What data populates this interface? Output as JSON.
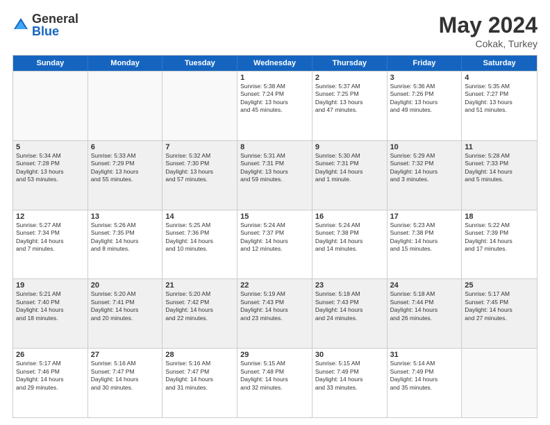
{
  "logo": {
    "general": "General",
    "blue": "Blue"
  },
  "title": {
    "month_year": "May 2024",
    "location": "Cokak, Turkey"
  },
  "weekdays": [
    "Sunday",
    "Monday",
    "Tuesday",
    "Wednesday",
    "Thursday",
    "Friday",
    "Saturday"
  ],
  "rows": [
    [
      {
        "day": "",
        "info": ""
      },
      {
        "day": "",
        "info": ""
      },
      {
        "day": "",
        "info": ""
      },
      {
        "day": "1",
        "info": "Sunrise: 5:38 AM\nSunset: 7:24 PM\nDaylight: 13 hours\nand 45 minutes."
      },
      {
        "day": "2",
        "info": "Sunrise: 5:37 AM\nSunset: 7:25 PM\nDaylight: 13 hours\nand 47 minutes."
      },
      {
        "day": "3",
        "info": "Sunrise: 5:36 AM\nSunset: 7:26 PM\nDaylight: 13 hours\nand 49 minutes."
      },
      {
        "day": "4",
        "info": "Sunrise: 5:35 AM\nSunset: 7:27 PM\nDaylight: 13 hours\nand 51 minutes."
      }
    ],
    [
      {
        "day": "5",
        "info": "Sunrise: 5:34 AM\nSunset: 7:28 PM\nDaylight: 13 hours\nand 53 minutes."
      },
      {
        "day": "6",
        "info": "Sunrise: 5:33 AM\nSunset: 7:29 PM\nDaylight: 13 hours\nand 55 minutes."
      },
      {
        "day": "7",
        "info": "Sunrise: 5:32 AM\nSunset: 7:30 PM\nDaylight: 13 hours\nand 57 minutes."
      },
      {
        "day": "8",
        "info": "Sunrise: 5:31 AM\nSunset: 7:31 PM\nDaylight: 13 hours\nand 59 minutes."
      },
      {
        "day": "9",
        "info": "Sunrise: 5:30 AM\nSunset: 7:31 PM\nDaylight: 14 hours\nand 1 minute."
      },
      {
        "day": "10",
        "info": "Sunrise: 5:29 AM\nSunset: 7:32 PM\nDaylight: 14 hours\nand 3 minutes."
      },
      {
        "day": "11",
        "info": "Sunrise: 5:28 AM\nSunset: 7:33 PM\nDaylight: 14 hours\nand 5 minutes."
      }
    ],
    [
      {
        "day": "12",
        "info": "Sunrise: 5:27 AM\nSunset: 7:34 PM\nDaylight: 14 hours\nand 7 minutes."
      },
      {
        "day": "13",
        "info": "Sunrise: 5:26 AM\nSunset: 7:35 PM\nDaylight: 14 hours\nand 8 minutes."
      },
      {
        "day": "14",
        "info": "Sunrise: 5:25 AM\nSunset: 7:36 PM\nDaylight: 14 hours\nand 10 minutes."
      },
      {
        "day": "15",
        "info": "Sunrise: 5:24 AM\nSunset: 7:37 PM\nDaylight: 14 hours\nand 12 minutes."
      },
      {
        "day": "16",
        "info": "Sunrise: 5:24 AM\nSunset: 7:38 PM\nDaylight: 14 hours\nand 14 minutes."
      },
      {
        "day": "17",
        "info": "Sunrise: 5:23 AM\nSunset: 7:38 PM\nDaylight: 14 hours\nand 15 minutes."
      },
      {
        "day": "18",
        "info": "Sunrise: 5:22 AM\nSunset: 7:39 PM\nDaylight: 14 hours\nand 17 minutes."
      }
    ],
    [
      {
        "day": "19",
        "info": "Sunrise: 5:21 AM\nSunset: 7:40 PM\nDaylight: 14 hours\nand 18 minutes."
      },
      {
        "day": "20",
        "info": "Sunrise: 5:20 AM\nSunset: 7:41 PM\nDaylight: 14 hours\nand 20 minutes."
      },
      {
        "day": "21",
        "info": "Sunrise: 5:20 AM\nSunset: 7:42 PM\nDaylight: 14 hours\nand 22 minutes."
      },
      {
        "day": "22",
        "info": "Sunrise: 5:19 AM\nSunset: 7:43 PM\nDaylight: 14 hours\nand 23 minutes."
      },
      {
        "day": "23",
        "info": "Sunrise: 5:18 AM\nSunset: 7:43 PM\nDaylight: 14 hours\nand 24 minutes."
      },
      {
        "day": "24",
        "info": "Sunrise: 5:18 AM\nSunset: 7:44 PM\nDaylight: 14 hours\nand 26 minutes."
      },
      {
        "day": "25",
        "info": "Sunrise: 5:17 AM\nSunset: 7:45 PM\nDaylight: 14 hours\nand 27 minutes."
      }
    ],
    [
      {
        "day": "26",
        "info": "Sunrise: 5:17 AM\nSunset: 7:46 PM\nDaylight: 14 hours\nand 29 minutes."
      },
      {
        "day": "27",
        "info": "Sunrise: 5:16 AM\nSunset: 7:47 PM\nDaylight: 14 hours\nand 30 minutes."
      },
      {
        "day": "28",
        "info": "Sunrise: 5:16 AM\nSunset: 7:47 PM\nDaylight: 14 hours\nand 31 minutes."
      },
      {
        "day": "29",
        "info": "Sunrise: 5:15 AM\nSunset: 7:48 PM\nDaylight: 14 hours\nand 32 minutes."
      },
      {
        "day": "30",
        "info": "Sunrise: 5:15 AM\nSunset: 7:49 PM\nDaylight: 14 hours\nand 33 minutes."
      },
      {
        "day": "31",
        "info": "Sunrise: 5:14 AM\nSunset: 7:49 PM\nDaylight: 14 hours\nand 35 minutes."
      },
      {
        "day": "",
        "info": ""
      }
    ]
  ]
}
